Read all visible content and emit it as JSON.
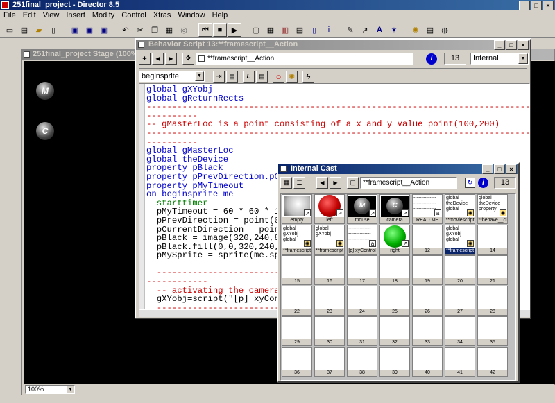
{
  "app": {
    "title": "251final_project - Director 8.5"
  },
  "menubar": [
    "File",
    "Edit",
    "View",
    "Insert",
    "Modify",
    "Control",
    "Xtras",
    "Window",
    "Help"
  ],
  "stage": {
    "title": "251final_project Stage (100%)",
    "sprites": [
      {
        "letter": "M"
      },
      {
        "letter": "C"
      }
    ],
    "zoom": "100%"
  },
  "script_window": {
    "title": "Behavior Script 13:**framescript__Action",
    "name_field": "**framescript__Action",
    "member_number": "13",
    "cast_select": "Internal",
    "handler_select": "beginsprite",
    "lines": [
      {
        "t": "global gXYobj",
        "c": "blue"
      },
      {
        "t": "global gReturnRects",
        "c": "blue"
      },
      {
        "t": "----------------------------------------------------------------------------------------------------",
        "c": "red"
      },
      {
        "t": "----------",
        "c": "red"
      },
      {
        "t": "-- gMasterLoc is a point consisting of a x and y value point(100,200)",
        "c": "red"
      },
      {
        "t": "----------------------------------------------------------------------------------------------------",
        "c": "red"
      },
      {
        "t": "----------",
        "c": "red"
      },
      {
        "t": "global gMasterLoc",
        "c": "blue"
      },
      {
        "t": "global theDevice",
        "c": "blue"
      },
      {
        "t": "property pBlack",
        "c": "blue"
      },
      {
        "t": "property pPrevDirection.pCurrentDirection",
        "c": "blue"
      },
      {
        "t": "property pMyTimeout",
        "c": "blue"
      },
      {
        "t": "on beginsprite me",
        "c": "blue"
      },
      {
        "t": "  starttimer",
        "c": "green"
      },
      {
        "t": "  pMyTimeout = 60 * 60 * 1",
        "c": "black"
      },
      {
        "t": "  pPrevDirection = point(0,0)",
        "c": "black"
      },
      {
        "t": "  pCurrentDirection = point(0,0)",
        "c": "black"
      },
      {
        "t": "  pBlack = image(320,240,8)",
        "c": "black"
      },
      {
        "t": "  pBlack.fill(0,0,320,240,rgb(0,0,0))",
        "c": "black"
      },
      {
        "t": "  pMySprite = sprite(me.spriteNum)",
        "c": "black"
      },
      {
        "t": "",
        "c": "black"
      },
      {
        "t": "  ---------------------------------------------------------------",
        "c": "red"
      },
      {
        "t": "------------",
        "c": "red"
      },
      {
        "t": "  -- activating the camera",
        "c": "red"
      },
      {
        "t": "  gXYobj=script(\"[p] xyControl\").new()",
        "c": "black"
      },
      {
        "t": "  ---------------------------------------------------------------",
        "c": "red"
      }
    ]
  },
  "cast_window": {
    "title": "Internal Cast",
    "name_field": "**framescript__Action",
    "member_number": "13",
    "cells": [
      {
        "label": "empty",
        "kind": "bitmap-white"
      },
      {
        "label": "left",
        "kind": "bitmap-red"
      },
      {
        "label": "mouse",
        "kind": "bitmap-m"
      },
      {
        "label": "camera",
        "kind": "bitmap-c"
      },
      {
        "label": "READ ME",
        "kind": "text",
        "text": "--------------\n--------------\n--------------"
      },
      {
        "label": "**moviescript",
        "kind": "script",
        "text": "global\ntheDevice\nglobal"
      },
      {
        "label": "**behave__cl",
        "kind": "script",
        "text": "global\ntheDevice\nproperty"
      },
      {
        "label": "**framescript",
        "kind": "script",
        "text": "global\ngXYobj\nglobal"
      },
      {
        "label": "**framescript",
        "kind": "script",
        "text": "global\ngXYobj"
      },
      {
        "label": "[p] xyControl",
        "kind": "text",
        "text": "--------------\n--------------\n--------------"
      },
      {
        "label": "right",
        "kind": "bitmap-green"
      },
      {
        "label": "12",
        "kind": "empty"
      },
      {
        "label": "**framescript",
        "kind": "script-sel",
        "text": "global\ngXYobj\nglobal"
      },
      {
        "label": "14",
        "kind": "empty"
      },
      {
        "label": "15",
        "kind": "empty"
      },
      {
        "label": "16",
        "kind": "empty"
      },
      {
        "label": "17",
        "kind": "empty"
      },
      {
        "label": "18",
        "kind": "empty"
      },
      {
        "label": "19",
        "kind": "empty"
      },
      {
        "label": "20",
        "kind": "empty"
      },
      {
        "label": "21",
        "kind": "empty"
      },
      {
        "label": "22",
        "kind": "empty"
      },
      {
        "label": "23",
        "kind": "empty"
      },
      {
        "label": "24",
        "kind": "empty"
      },
      {
        "label": "25",
        "kind": "empty"
      },
      {
        "label": "26",
        "kind": "empty"
      },
      {
        "label": "27",
        "kind": "empty"
      },
      {
        "label": "28",
        "kind": "empty"
      },
      {
        "label": "29",
        "kind": "empty"
      },
      {
        "label": "30",
        "kind": "empty"
      },
      {
        "label": "31",
        "kind": "empty"
      },
      {
        "label": "32",
        "kind": "empty"
      },
      {
        "label": "33",
        "kind": "empty"
      },
      {
        "label": "34",
        "kind": "empty"
      },
      {
        "label": "35",
        "kind": "empty"
      },
      {
        "label": "36",
        "kind": "empty"
      },
      {
        "label": "37",
        "kind": "empty"
      },
      {
        "label": "38",
        "kind": "empty"
      },
      {
        "label": "39",
        "kind": "empty"
      },
      {
        "label": "40",
        "kind": "empty"
      },
      {
        "label": "41",
        "kind": "empty"
      },
      {
        "label": "42",
        "kind": "empty"
      }
    ]
  }
}
